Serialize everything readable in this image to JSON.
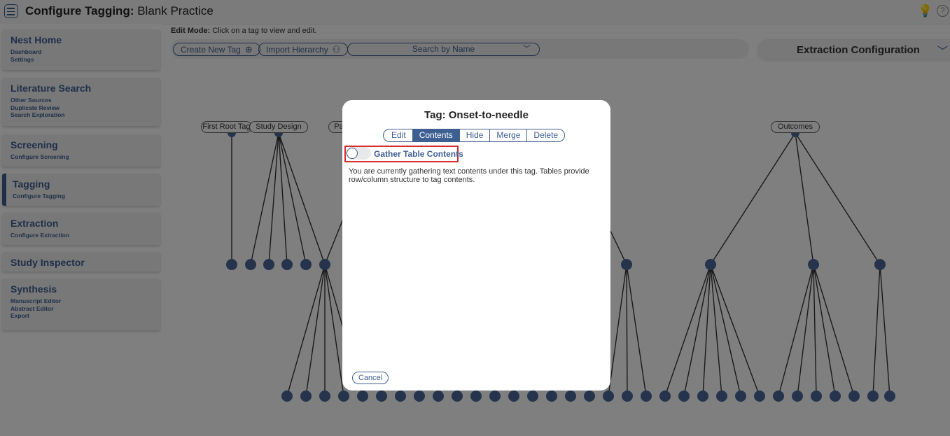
{
  "header": {
    "title_bold": "Configure Tagging:",
    "title_rest": " Blank Practice",
    "bulb_glyph": "💡",
    "help_glyph": "?"
  },
  "sidebar": {
    "sections": [
      {
        "title": "Nest Home",
        "links": [
          "Dashboard",
          "Settings"
        ],
        "active": false
      },
      {
        "title": "Literature Search",
        "links": [
          "Other Sources",
          "Duplicate Review",
          "Search Exploration"
        ],
        "active": false
      },
      {
        "title": "Screening",
        "links": [
          "Configure Screening"
        ],
        "active": false
      },
      {
        "title": "Tagging",
        "links": [
          "Configure Tagging"
        ],
        "active": true
      },
      {
        "title": "Extraction",
        "links": [
          "Configure Extraction"
        ],
        "active": false
      },
      {
        "title": "Study Inspector",
        "links": [],
        "active": false
      },
      {
        "title": "Synthesis",
        "links": [
          "Manuscript Editor",
          "Abstract Editor",
          "Export"
        ],
        "active": false
      }
    ]
  },
  "toolbar": {
    "edit_mode_label": "Edit Mode:",
    "edit_mode_text": " Click on a tag to view and edit.",
    "create_tag_label": "Create New Tag",
    "import_hierarchy_label": "Import Hierarchy",
    "search_placeholder": "Search by Name",
    "extraction_config_label": "Extraction Configuration"
  },
  "tree": {
    "root_tags": [
      "First Root Tag",
      "Study Design",
      "Pa",
      "Outcomes"
    ]
  },
  "modal": {
    "title": "Tag: Onset-to-needle",
    "tabs": [
      "Edit",
      "Contents",
      "Hide",
      "Merge",
      "Delete"
    ],
    "active_tab": "Contents",
    "toggle_label": "Gather Table Contents",
    "toggle_on": false,
    "description": "You are currently gathering text contents under this tag. Tables provide row/column structure to tag contents.",
    "cancel_label": "Cancel"
  },
  "colors": {
    "accent": "#3e5f91",
    "node": "#4a6898",
    "highlight": "#d62b2b",
    "bulb": "#e2a126"
  }
}
